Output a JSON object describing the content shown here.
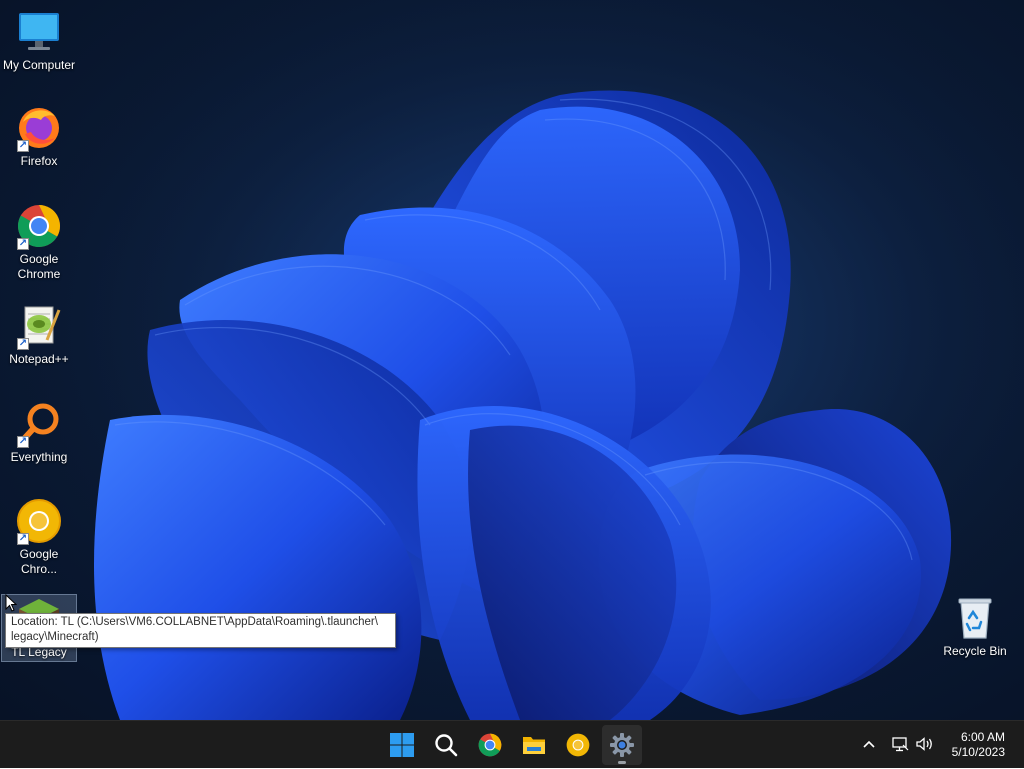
{
  "desktop": {
    "icons": [
      {
        "label": "My Computer",
        "icon": "monitor-icon"
      },
      {
        "label": "Firefox",
        "icon": "firefox-icon"
      },
      {
        "label": "Google Chrome",
        "icon": "chrome-icon"
      },
      {
        "label": "Notepad++",
        "icon": "notepadpp-icon"
      },
      {
        "label": "Everything",
        "icon": "everything-search-icon"
      },
      {
        "label": "Google Chro...",
        "icon": "chrome-canary-icon"
      },
      {
        "label": "TL Legacy",
        "icon": "tl-legacy-icon"
      },
      {
        "label": "Recycle Bin",
        "icon": "recycle-bin-icon"
      }
    ],
    "tooltip": "Location: TL (C:\\Users\\VM6.COLLABNET\\AppData\\Roaming\\.tlauncher\\\nlegacy\\Minecraft)"
  },
  "taskbar": {
    "pinned": [
      {
        "name": "start-button",
        "icon": "windows-logo-icon"
      },
      {
        "name": "search-button",
        "icon": "search-icon"
      },
      {
        "name": "chrome-button",
        "icon": "chrome-icon"
      },
      {
        "name": "file-explorer-button",
        "icon": "folder-icon"
      },
      {
        "name": "chrome-canary-button",
        "icon": "chrome-canary-icon"
      },
      {
        "name": "settings-button",
        "icon": "gear-icon"
      }
    ],
    "tray": {
      "icons": [
        "chevron-up-icon",
        "network-icon",
        "volume-icon"
      ]
    },
    "clock": {
      "time": "6:00 AM",
      "date": "5/10/2023"
    }
  },
  "colors": {
    "wallpaper_bg": "#0b1c38",
    "bloom_blue": "#1f4fe0",
    "taskbar_bg": "#1c1c1c",
    "windows_blue": "#2d9cf0"
  }
}
